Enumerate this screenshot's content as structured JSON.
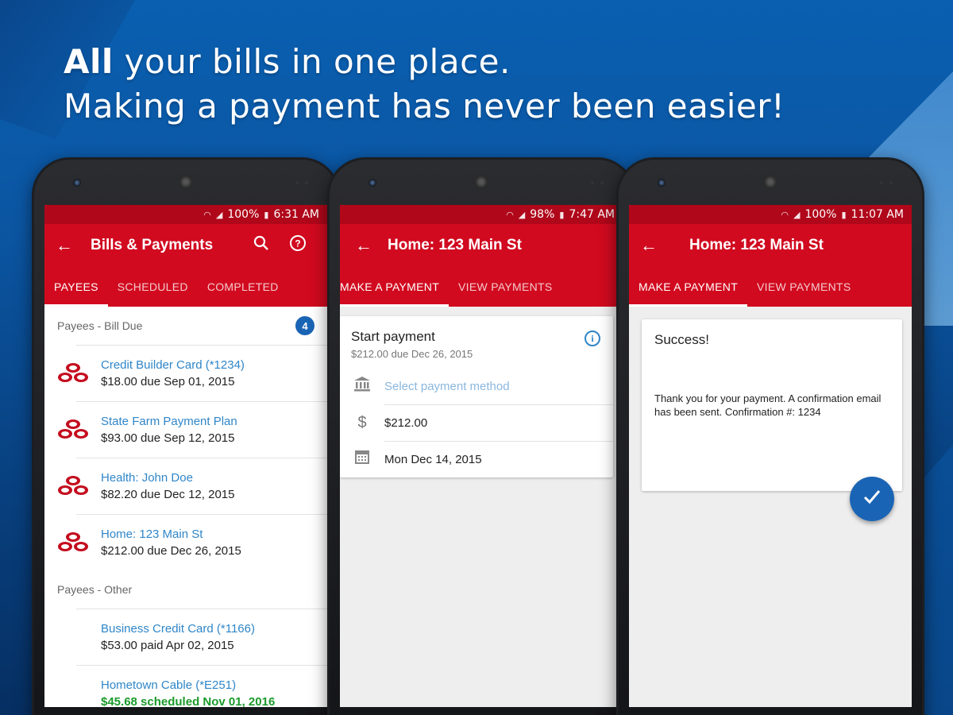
{
  "headline": {
    "line1_bold": "All",
    "line1_rest": " your bills in one place.",
    "line2": "Making a payment has never been easier!"
  },
  "colors": {
    "brand_red": "#d10a1f",
    "link_blue": "#2f86c8",
    "accent_blue": "#1a64b5",
    "scheduled_green": "#1a9a2a"
  },
  "phone1": {
    "status": {
      "battery": "100%",
      "time": "6:31 AM"
    },
    "appbar": {
      "title": "Bills & Payments",
      "back_icon": "arrow-left-icon",
      "search_icon": "search-icon",
      "help_icon": "help-icon"
    },
    "tabs": [
      "PAYEES",
      "SCHEDULED",
      "COMPLETED"
    ],
    "active_tab": "PAYEES",
    "section_due": {
      "label": "Payees - Bill Due",
      "count": "4"
    },
    "due_items": [
      {
        "name": "Credit Builder Card (*1234)",
        "detail": "$18.00 due Sep 01, 2015"
      },
      {
        "name": "State Farm Payment Plan",
        "detail": "$93.00 due Sep 12, 2015"
      },
      {
        "name": "Health: John Doe",
        "detail": "$82.20 due Dec 12, 2015"
      },
      {
        "name": "Home: 123 Main St",
        "detail": "$212.00 due Dec 26, 2015"
      }
    ],
    "section_other": {
      "label": "Payees - Other"
    },
    "other_items": [
      {
        "name": "Business Credit Card (*1166)",
        "detail": "$53.00 paid Apr 02, 2015"
      },
      {
        "name": "Hometown Cable (*E251)",
        "detail": "$45.68 scheduled Nov 01, 2016"
      }
    ]
  },
  "phone2": {
    "status": {
      "battery": "98%",
      "time": "7:47 AM"
    },
    "appbar": {
      "title": "Home: 123 Main St"
    },
    "tabs": [
      "MAKE A PAYMENT",
      "VIEW PAYMENTS"
    ],
    "active_tab": "MAKE A PAYMENT",
    "card": {
      "title": "Start payment",
      "subtitle": "$212.00 due Dec 26, 2015",
      "method_placeholder": "Select payment method",
      "amount": "$212.00",
      "date": "Mon Dec 14, 2015",
      "amount_symbol": "$"
    }
  },
  "phone3": {
    "status": {
      "battery": "100%",
      "time": "11:07 AM"
    },
    "appbar": {
      "title": "Home: 123 Main St"
    },
    "tabs": [
      "MAKE A PAYMENT",
      "VIEW PAYMENTS"
    ],
    "active_tab": "MAKE A PAYMENT",
    "card": {
      "title": "Success!",
      "message": "Thank you for your payment. A confirmation email has been sent. Confirmation #: 1234"
    }
  }
}
